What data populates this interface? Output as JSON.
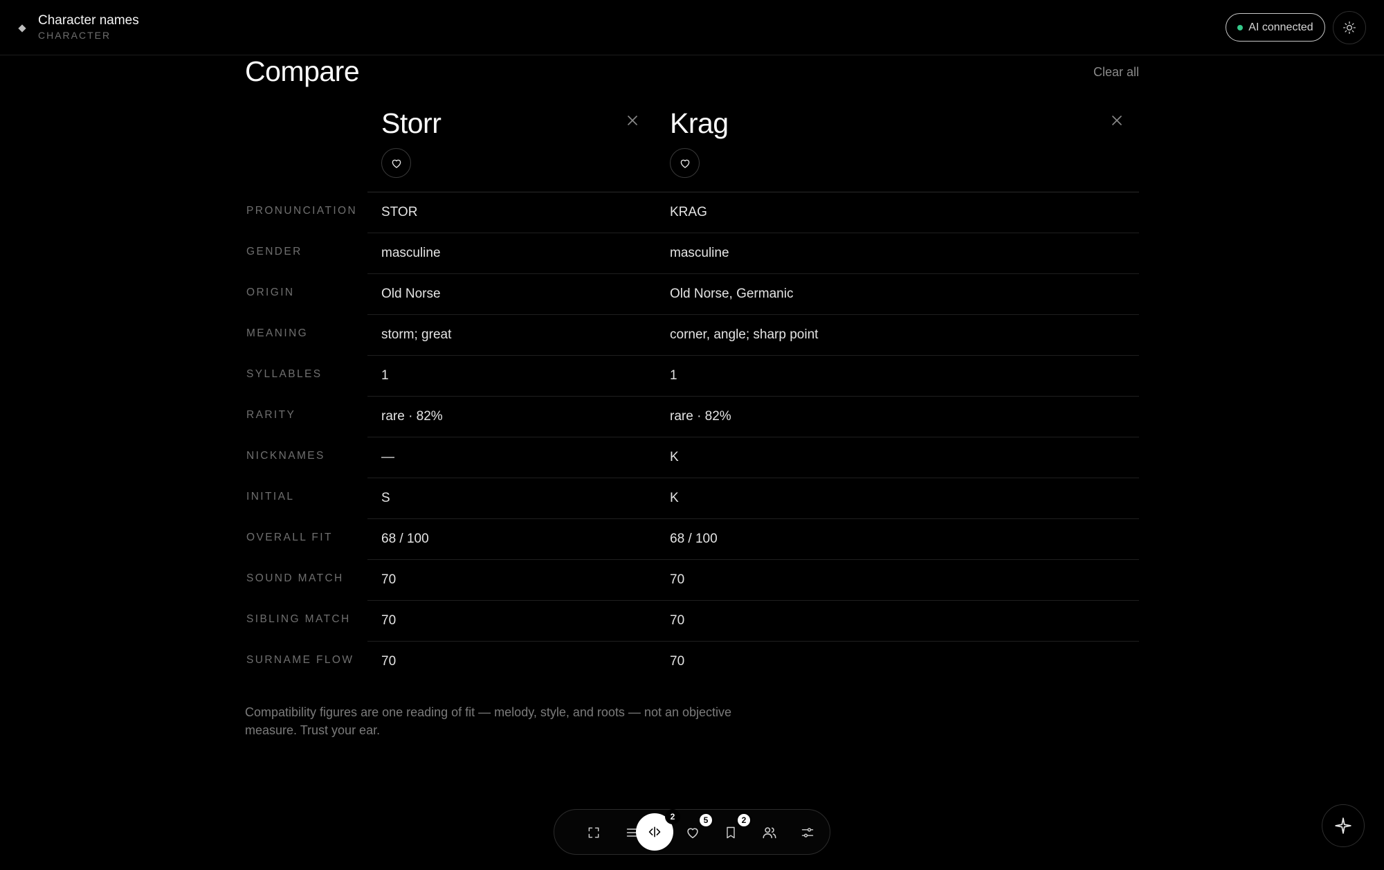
{
  "app": {
    "title": "Character names",
    "subtitle": "CHARACTER"
  },
  "status": {
    "ai_label": "AI connected",
    "ai_color": "#35c98a"
  },
  "compare": {
    "title": "Compare",
    "clear_all": "Clear all",
    "columns": [
      {
        "name": "Storr"
      },
      {
        "name": "Krag"
      }
    ],
    "rows": [
      {
        "label": "PRONUNCIATION",
        "values": [
          "STOR",
          "KRAG"
        ]
      },
      {
        "label": "GENDER",
        "values": [
          "masculine",
          "masculine"
        ]
      },
      {
        "label": "ORIGIN",
        "values": [
          "Old Norse",
          "Old Norse, Germanic"
        ]
      },
      {
        "label": "MEANING",
        "values": [
          "storm; great",
          "corner, angle; sharp point"
        ]
      },
      {
        "label": "SYLLABLES",
        "values": [
          "1",
          "1"
        ]
      },
      {
        "label": "RARITY",
        "values": [
          "rare · 82%",
          "rare · 82%"
        ]
      },
      {
        "label": "NICKNAMES",
        "values": [
          "—",
          "K"
        ]
      },
      {
        "label": "INITIAL",
        "values": [
          "S",
          "K"
        ]
      },
      {
        "label": "OVERALL FIT",
        "values": [
          "68 / 100",
          "68 / 100"
        ]
      },
      {
        "label": "SOUND MATCH",
        "values": [
          "70",
          "70"
        ]
      },
      {
        "label": "SIBLING MATCH",
        "values": [
          "70",
          "70"
        ]
      },
      {
        "label": "SURNAME FLOW",
        "values": [
          "70",
          "70"
        ]
      }
    ],
    "footnote": "Compatibility figures are one reading of fit — melody, style, and roots — not an objective measure. Trust your ear."
  },
  "dock": {
    "items": [
      {
        "name": "fullscreen-icon"
      },
      {
        "name": "list-icon"
      },
      {
        "name": "compare-icon",
        "badge": "2",
        "active": true
      },
      {
        "name": "heart-icon",
        "badge": "5"
      },
      {
        "name": "bookmark-icon",
        "badge": "2"
      },
      {
        "name": "people-icon"
      },
      {
        "name": "sliders-icon"
      }
    ]
  },
  "assistant": {
    "icon": "sparkle-icon"
  }
}
